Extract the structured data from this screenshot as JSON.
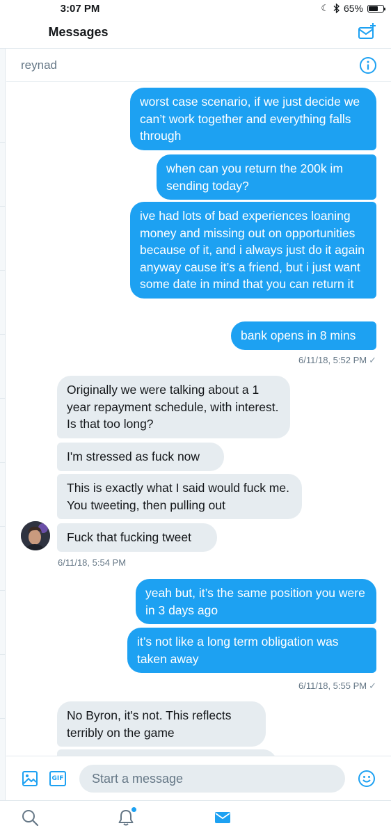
{
  "status_bar": {
    "time": "3:07 PM",
    "battery_percent": "65%",
    "battery_level": 0.65
  },
  "header": {
    "title": "Messages",
    "compose_icon": "compose-message-icon"
  },
  "conversation": {
    "name": "reynad",
    "info_icon": "info-icon"
  },
  "messages": [
    {
      "direction": "out",
      "text": "worst case scenario, if we just decide we can’t work together and everything falls through"
    },
    {
      "direction": "out",
      "text": "when can you return the 200k im sending today?"
    },
    {
      "direction": "out",
      "text": "ive had lots of bad experiences loaning money and missing out on opportunities because of it, and i always just do it again anyway cause it’s a friend, but i just want some date in mind that you can return it"
    },
    {
      "direction": "out",
      "text": "bank opens in 8 mins"
    },
    {
      "direction": "in",
      "text": "Originally we were talking about a 1 year repayment schedule, with interest. Is that too long?"
    },
    {
      "direction": "in",
      "text": "I'm stressed as fuck now"
    },
    {
      "direction": "in",
      "text": "This is exactly what I said would fuck me. You tweeting, then pulling out"
    },
    {
      "direction": "in",
      "text": "Fuck that fucking tweet"
    },
    {
      "direction": "out",
      "text": "yeah but, it’s the same position you were in 3 days ago"
    },
    {
      "direction": "out",
      "text": "it’s not like a long term obligation was taken away"
    },
    {
      "direction": "in",
      "text": "No Byron, it's not. This reflects terribly on the game"
    }
  ],
  "timestamps": {
    "group1": "6/11/18, 5:52 PM",
    "group2": "6/11/18, 5:54 PM",
    "group3": "6/11/18, 5:55 PM",
    "read_mark": "✓"
  },
  "composer": {
    "placeholder": "Start a message",
    "gif_label": "GIF",
    "media_icon": "image-icon",
    "emoji_icon": "emoji-icon"
  },
  "tabbar": {
    "items": [
      "search-icon",
      "notifications-icon",
      "messages-icon"
    ],
    "active": "messages-icon"
  },
  "colors": {
    "accent": "#1da1f2",
    "incoming_bubble": "#e6ecf0",
    "text": "#14171a",
    "muted": "#657786",
    "border": "#e1e8ed"
  }
}
